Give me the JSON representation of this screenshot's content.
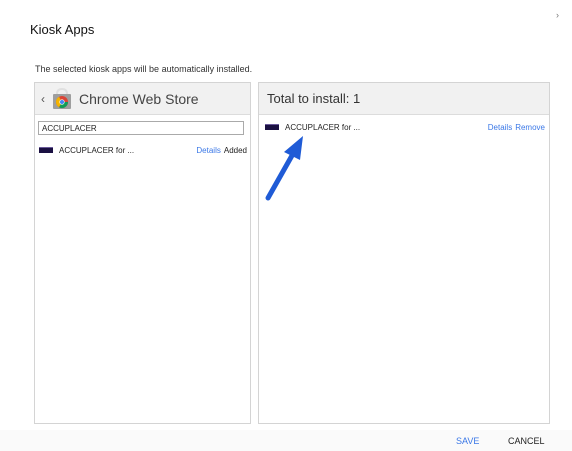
{
  "dialog": {
    "title": "Kiosk Apps",
    "description": "The selected kiosk apps will be automatically installed."
  },
  "store": {
    "title": "Chrome Web Store",
    "search_value": "ACCUPLACER",
    "results": [
      {
        "name": "ACCUPLACER for ...",
        "details_label": "Details",
        "status": "Added"
      }
    ]
  },
  "install": {
    "title": "Total to install: 1",
    "items": [
      {
        "name": "ACCUPLACER for ...",
        "details_label": "Details",
        "remove_label": "Remove"
      }
    ]
  },
  "footer": {
    "save_label": "SAVE",
    "cancel_label": "CANCEL"
  },
  "colors": {
    "accent": "#3b78e7",
    "annotation_arrow": "#1f5bd6",
    "app_icon": "#1a1042"
  },
  "icons": {
    "close": "close-icon",
    "back": "chevron-left-icon",
    "store": "chrome-web-store-icon",
    "app": "accuplacer-app-icon",
    "annotation": "arrow-icon"
  }
}
